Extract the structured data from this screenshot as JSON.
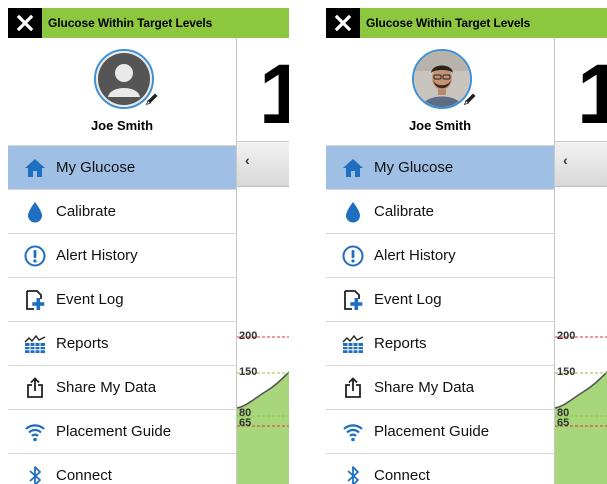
{
  "panels": [
    {
      "id": "left",
      "avatar": "default-silhouette",
      "header_title": "Glucose Within Target Levels",
      "user_name": "Joe Smith",
      "big_reading": "1",
      "chart_ticks": [
        "200",
        "150",
        "80",
        "65"
      ]
    },
    {
      "id": "right",
      "avatar": "user-photo",
      "header_title": "Glucose Within Target Levels",
      "user_name": "Joe Smith",
      "big_reading": "1",
      "chart_ticks": [
        "200",
        "150",
        "80",
        "65"
      ]
    }
  ],
  "menu_items": [
    {
      "key": "my-glucose",
      "label": "My Glucose",
      "icon": "home-icon",
      "active": true
    },
    {
      "key": "calibrate",
      "label": "Calibrate",
      "icon": "drop-icon",
      "active": false
    },
    {
      "key": "alert-history",
      "label": "Alert History",
      "icon": "alert-icon",
      "active": false
    },
    {
      "key": "event-log",
      "label": "Event Log",
      "icon": "event-log-icon",
      "active": false
    },
    {
      "key": "reports",
      "label": "Reports",
      "icon": "reports-icon",
      "active": false
    },
    {
      "key": "share-my-data",
      "label": "Share My Data",
      "icon": "share-icon",
      "active": false
    },
    {
      "key": "placement-guide",
      "label": "Placement Guide",
      "icon": "wifi-icon",
      "active": false
    },
    {
      "key": "connect",
      "label": "Connect",
      "icon": "bluetooth-icon",
      "active": false
    }
  ],
  "colors": {
    "header": "#8dc63f",
    "active_row": "#9fc0e4",
    "icon_blue": "#1f6fc0",
    "high_line": "#e0353a",
    "target_line": "#8dc63f",
    "chart_fill": "#a7d77a"
  }
}
